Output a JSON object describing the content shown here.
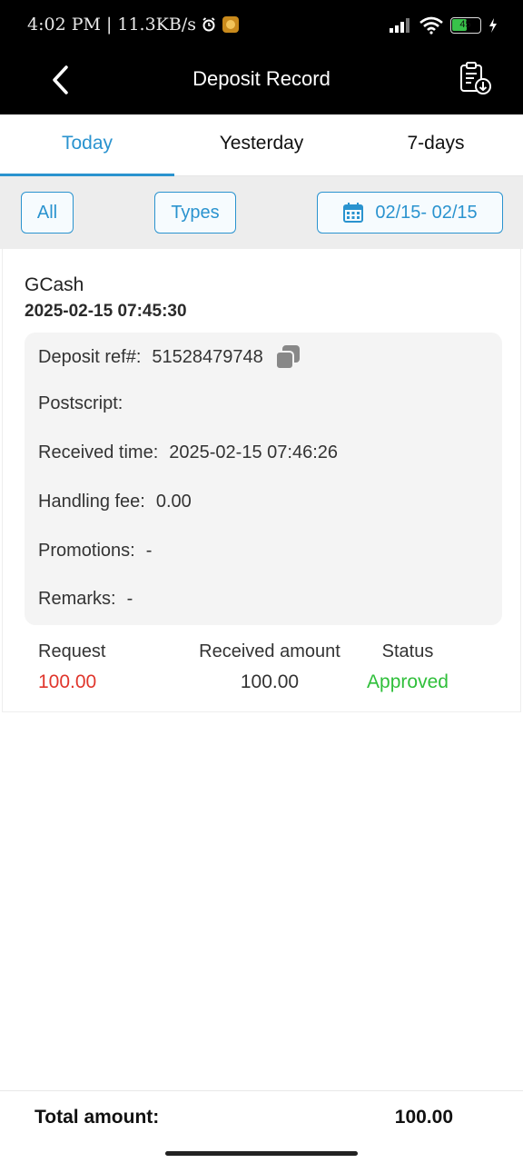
{
  "status_bar": {
    "time": "4:02 PM",
    "separator": "|",
    "speed": "11.3KB/s",
    "battery": "45"
  },
  "nav": {
    "title": "Deposit Record"
  },
  "tabs": [
    {
      "label": "Today",
      "active": true
    },
    {
      "label": "Yesterday",
      "active": false
    },
    {
      "label": "7-days",
      "active": false
    }
  ],
  "filters": {
    "all": "All",
    "types": "Types",
    "date_range": "02/15- 02/15"
  },
  "record": {
    "method": "GCash",
    "created_time": "2025-02-15 07:45:30",
    "details": {
      "ref_label": "Deposit ref#:",
      "ref_value": "51528479748",
      "postscript_label": "Postscript:",
      "postscript_value": "",
      "received_label": "Received time:",
      "received_value": "2025-02-15 07:46:26",
      "fee_label": "Handling fee:",
      "fee_value": "0.00",
      "promotions_label": "Promotions:",
      "promotions_value": "-",
      "remarks_label": "Remarks:",
      "remarks_value": "-"
    },
    "summary": {
      "request_label": "Request",
      "request_value": "100.00",
      "received_label": "Received amount",
      "received_value": "100.00",
      "status_label": "Status",
      "status_value": "Approved"
    }
  },
  "footer": {
    "total_label": "Total amount:",
    "total_value": "100.00"
  },
  "colors": {
    "accent": "#2a93cf",
    "request": "#e0362c",
    "approved": "#2fbf3a"
  }
}
